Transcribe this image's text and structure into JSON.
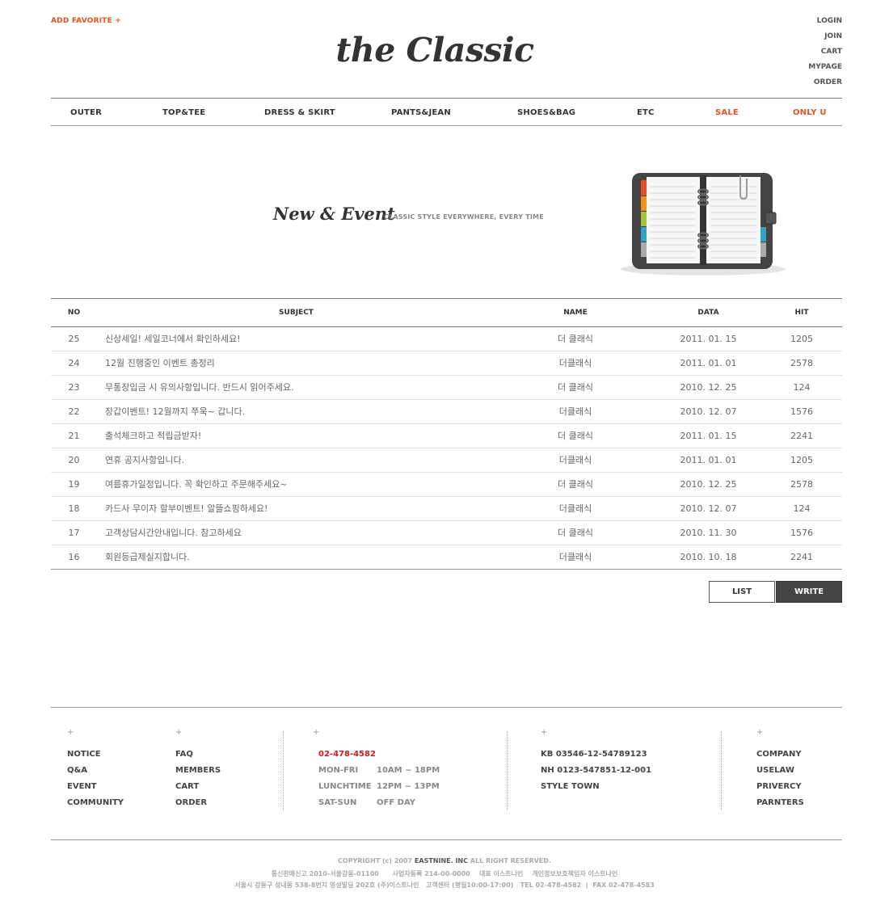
{
  "header": {
    "add_favorite": "ADD FAVORITE +",
    "logo": "the Classic",
    "top_links": [
      "LOGIN",
      "JOIN",
      "CART",
      "MYPAGE",
      "ORDER"
    ]
  },
  "nav": [
    "OUTER",
    "TOP&TEE",
    "DRESS & SKIRT",
    "PANTS&JEAN",
    "SHOES&BAG",
    "ETC",
    "SALE",
    "ONLY U"
  ],
  "colors": {
    "accent": "#e5521f",
    "phone": "#cc1b1b",
    "write_button": "#444444"
  },
  "section": {
    "title": "New & Event",
    "subtitle": "CLASSIC STYLE EVERYWHERE, EVERY TIME",
    "illustration": "planner-icon"
  },
  "board": {
    "headers": {
      "no": "NO",
      "subject": "SUBJECT",
      "name": "NAME",
      "data": "DATA",
      "hit": "HIT"
    },
    "rows": [
      {
        "no": "25",
        "subject": "신상세일! 세일코너에서 확인하세요!",
        "name": "더 클래식",
        "date": "2011. 01. 15",
        "hit": "1205"
      },
      {
        "no": "24",
        "subject": "12월 진행중인 이벤트 총정리",
        "name": "더클래식",
        "date": "2011. 01. 01",
        "hit": "2578"
      },
      {
        "no": "23",
        "subject": "무통장입금 시 유의사항입니다. 반드시 읽어주세요.",
        "name": "더 클래식",
        "date": "2010. 12. 25",
        "hit": "124"
      },
      {
        "no": "22",
        "subject": "장갑이벤트! 12월까지 쭈욱~ 갑니다.",
        "name": "더클래식",
        "date": "2010. 12. 07",
        "hit": "1576"
      },
      {
        "no": "21",
        "subject": "출석체크하고 적립금받자!",
        "name": "더 클래식",
        "date": "2011. 01. 15",
        "hit": "2241"
      },
      {
        "no": "20",
        "subject": "연휴 공지사항입니다.",
        "name": "더클래식",
        "date": "2011. 01. 01",
        "hit": "1205"
      },
      {
        "no": "19",
        "subject": "여름휴가일정입니다. 꼭 확인하고 주문해주세요~",
        "name": "더 클래식",
        "date": "2010. 12. 25",
        "hit": "2578"
      },
      {
        "no": "18",
        "subject": "카드사 무이자 할부이벤트! 알뜰쇼핑하세요!",
        "name": "더클래식",
        "date": "2010. 12. 07",
        "hit": "124"
      },
      {
        "no": "17",
        "subject": "고객상담시간안내입니다. 참고하세요",
        "name": "더 클래식",
        "date": "2010. 11. 30",
        "hit": "1576"
      },
      {
        "no": "16",
        "subject": "회원등급제실지합니다.",
        "name": "더클래식",
        "date": "2010. 10. 18",
        "hit": "2241"
      }
    ],
    "buttons": {
      "list": "LIST",
      "write": "WRITE"
    }
  },
  "footer": {
    "plus": "+",
    "col1": [
      "NOTICE",
      "Q&A",
      "EVENT",
      "COMMUNITY"
    ],
    "col2": [
      "FAQ",
      "MEMBERS",
      "CART",
      "ORDER"
    ],
    "cs": {
      "phone": "02-478-4582",
      "hours": [
        {
          "label": "MON-FRI",
          "value": "10AM ~ 18PM"
        },
        {
          "label": "LUNCHTIME",
          "value": "12PM ~ 13PM"
        },
        {
          "label": "SAT-SUN",
          "value": "OFF DAY"
        }
      ]
    },
    "bank": [
      "KB 03546-12-54789123",
      "NH 0123-547851-12-001",
      "STYLE TOWN"
    ],
    "col5": [
      "COMPANY",
      "USELAW",
      "PRIVERCY",
      "PARNTERS"
    ],
    "copyright": {
      "pre": "COPYRIGHT (c) 2007",
      "company": "EASTNINE. INC",
      "post": "ALL RIGHT RESERVED.",
      "line2": "통신판매신고 2010-서울강동-01100      사업자등록 214-00-0000    대표 이스트나인    개인정보보호책임자 이스트나인",
      "line3": "서울시 강동구 성내동 538-8번지 영성빌딩 202호 (주)이스트나인   고객센터 (평일10:00-17:00)   TEL 02-478-4582  |  FAX 02-478-4583"
    }
  }
}
